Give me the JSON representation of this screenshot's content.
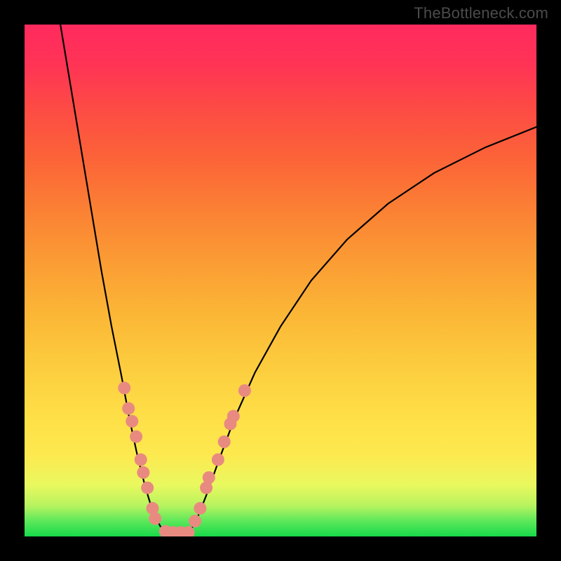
{
  "watermark": "TheBottleneck.com",
  "chart_data": {
    "type": "line",
    "title": "",
    "xlabel": "",
    "ylabel": "",
    "xlim": [
      0,
      100
    ],
    "ylim": [
      0,
      100
    ],
    "grid": false,
    "legend": false,
    "background_gradient": {
      "stops": [
        {
          "pos": 0,
          "color": "#17d94a"
        },
        {
          "pos": 3,
          "color": "#5ce85a"
        },
        {
          "pos": 6,
          "color": "#b7f35f"
        },
        {
          "pos": 10,
          "color": "#e9f85f"
        },
        {
          "pos": 16,
          "color": "#fde94f"
        },
        {
          "pos": 24,
          "color": "#fede47"
        },
        {
          "pos": 34,
          "color": "#fccb3d"
        },
        {
          "pos": 44,
          "color": "#fbb536"
        },
        {
          "pos": 54,
          "color": "#fb9b34"
        },
        {
          "pos": 64,
          "color": "#fb8034"
        },
        {
          "pos": 74,
          "color": "#fc6338"
        },
        {
          "pos": 84,
          "color": "#fd4a45"
        },
        {
          "pos": 92,
          "color": "#ff3455"
        },
        {
          "pos": 100,
          "color": "#ff2a5e"
        }
      ]
    },
    "series": [
      {
        "name": "left-branch",
        "color": "#000000",
        "points": [
          {
            "x": 7.0,
            "y": 100.0
          },
          {
            "x": 9.0,
            "y": 88.0
          },
          {
            "x": 11.0,
            "y": 76.0
          },
          {
            "x": 13.0,
            "y": 64.0
          },
          {
            "x": 15.0,
            "y": 52.0
          },
          {
            "x": 17.0,
            "y": 41.0
          },
          {
            "x": 19.0,
            "y": 31.0
          },
          {
            "x": 20.5,
            "y": 23.0
          },
          {
            "x": 22.0,
            "y": 16.0
          },
          {
            "x": 23.5,
            "y": 10.0
          },
          {
            "x": 25.0,
            "y": 5.0
          },
          {
            "x": 26.5,
            "y": 2.0
          },
          {
            "x": 28.0,
            "y": 0.5
          }
        ]
      },
      {
        "name": "right-branch",
        "color": "#000000",
        "points": [
          {
            "x": 32.0,
            "y": 0.5
          },
          {
            "x": 33.5,
            "y": 3.0
          },
          {
            "x": 35.5,
            "y": 8.0
          },
          {
            "x": 38.0,
            "y": 15.0
          },
          {
            "x": 41.0,
            "y": 23.0
          },
          {
            "x": 45.0,
            "y": 32.0
          },
          {
            "x": 50.0,
            "y": 41.0
          },
          {
            "x": 56.0,
            "y": 50.0
          },
          {
            "x": 63.0,
            "y": 58.0
          },
          {
            "x": 71.0,
            "y": 65.0
          },
          {
            "x": 80.0,
            "y": 71.0
          },
          {
            "x": 90.0,
            "y": 76.0
          },
          {
            "x": 100.0,
            "y": 80.0
          }
        ]
      }
    ],
    "markers": {
      "name": "beads",
      "color": "#e98a81",
      "radius_px": 9,
      "points": [
        {
          "x": 19.5,
          "y": 29.0
        },
        {
          "x": 20.3,
          "y": 25.0
        },
        {
          "x": 21.0,
          "y": 22.5
        },
        {
          "x": 21.8,
          "y": 19.5
        },
        {
          "x": 22.7,
          "y": 15.0
        },
        {
          "x": 23.2,
          "y": 12.5
        },
        {
          "x": 24.0,
          "y": 9.5
        },
        {
          "x": 25.0,
          "y": 5.5
        },
        {
          "x": 25.5,
          "y": 3.5
        },
        {
          "x": 27.5,
          "y": 1.0
        },
        {
          "x": 29.0,
          "y": 0.8
        },
        {
          "x": 30.5,
          "y": 0.8
        },
        {
          "x": 32.0,
          "y": 0.8
        },
        {
          "x": 33.3,
          "y": 3.0
        },
        {
          "x": 34.3,
          "y": 5.5
        },
        {
          "x": 35.5,
          "y": 9.5
        },
        {
          "x": 36.0,
          "y": 11.5
        },
        {
          "x": 37.8,
          "y": 15.0
        },
        {
          "x": 39.0,
          "y": 18.5
        },
        {
          "x": 40.2,
          "y": 22.0
        },
        {
          "x": 40.8,
          "y": 23.5
        },
        {
          "x": 43.0,
          "y": 28.5
        }
      ]
    }
  }
}
